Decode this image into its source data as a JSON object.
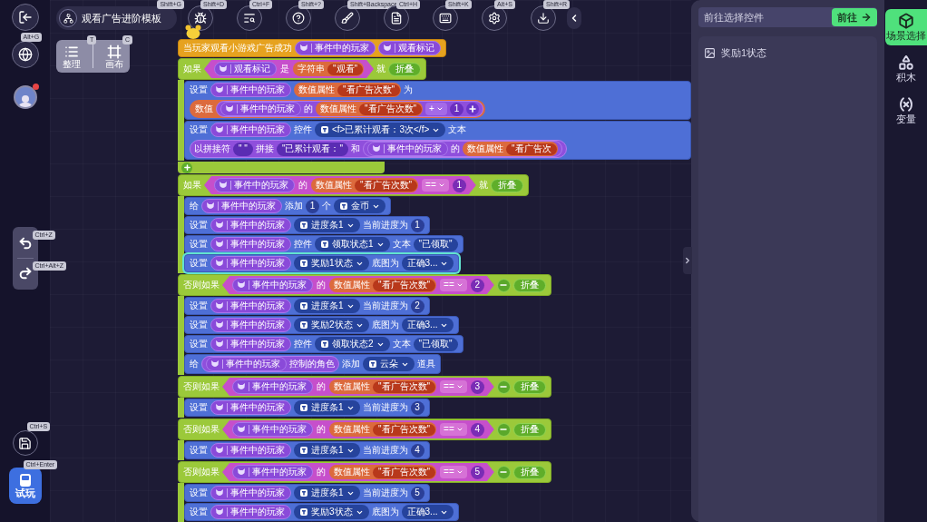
{
  "sidebar": {
    "globe_shortcut": "Alt+G",
    "avatar_notification": true,
    "undo_shortcut": "Ctrl+Z",
    "redo_shortcut": "Ctrl+Alt+Z",
    "save_shortcut": "Ctrl+S",
    "play": {
      "label": "试玩",
      "shortcut": "Ctrl+Enter"
    }
  },
  "project": {
    "title": "观看广告进阶模板",
    "shortcut": "Shift+G"
  },
  "tools": [
    {
      "shortcut": "Shift+D"
    },
    {
      "shortcut": "Ctrl+F"
    },
    {
      "shortcut": "Shift+?"
    },
    {
      "shortcut": "Shift+Backspace"
    },
    {
      "shortcut": "Ctrl+H"
    },
    {
      "shortcut": "Shift+K"
    },
    {
      "shortcut": "Alt+S"
    },
    {
      "shortcut": "Shift+R"
    }
  ],
  "arrange": {
    "tidy": {
      "label": "整理",
      "shortcut": "T"
    },
    "canvas": {
      "label": "画布",
      "shortcut": "C"
    }
  },
  "script": {
    "kind": "hat",
    "selected": false,
    "parts": [
      {
        "kind": "label",
        "text": "当玩家观看小游戏广告成功"
      },
      {
        "kind": "var",
        "text": "事件中的玩家"
      },
      {
        "kind": "var",
        "text": "观看标记"
      }
    ],
    "children": [
      {
        "kind": "if",
        "selected": false,
        "parts": [
          {
            "kind": "label",
            "text": "如果"
          },
          {
            "kind": "cond",
            "parts": [
              {
                "kind": "var",
                "text": "观看标记"
              },
              {
                "kind": "label",
                "text": "是"
              },
              {
                "kind": "attr",
                "label": "字符串",
                "value": "\"观看\""
              }
            ]
          },
          {
            "kind": "label",
            "text": "就"
          },
          {
            "kind": "fold",
            "text": "折叠"
          }
        ],
        "children": [
          {
            "kind": "stmt",
            "selected": false,
            "parts": [
              {
                "kind": "label",
                "text": "设置"
              },
              {
                "kind": "var",
                "text": "事件中的玩家"
              },
              {
                "kind": "attr",
                "label": "数值属性",
                "value": "\"看广告次数\""
              },
              {
                "kind": "label",
                "text": "为"
              },
              {
                "kind": "value",
                "label": "数值",
                "parts": [
                  {
                    "kind": "expr",
                    "parts": [
                      {
                        "kind": "var",
                        "text": "事件中的玩家"
                      },
                      {
                        "kind": "label",
                        "text": "的"
                      },
                      {
                        "kind": "attr",
                        "label": "数值属性",
                        "value": "\"看广告次数\""
                      },
                      {
                        "kind": "op",
                        "text": "+"
                      },
                      {
                        "kind": "num",
                        "text": "1"
                      },
                      {
                        "kind": "plus"
                      }
                    ]
                  }
                ]
              }
            ]
          },
          {
            "kind": "stmt",
            "selected": false,
            "parts": [
              {
                "kind": "label",
                "text": "设置"
              },
              {
                "kind": "var",
                "text": "事件中的玩家"
              },
              {
                "kind": "label",
                "text": "控件"
              },
              {
                "kind": "dropdown",
                "text": "<f>已累计观看：3次</f>",
                "icon": true
              },
              {
                "kind": "label",
                "text": "文本"
              },
              {
                "kind": "expr",
                "parts": [
                  {
                    "kind": "label",
                    "text": "以拼接符"
                  },
                  {
                    "kind": "str",
                    "text": "\" \""
                  },
                  {
                    "kind": "label",
                    "text": "拼接"
                  },
                  {
                    "kind": "str",
                    "text": "\"已累计观看：\""
                  },
                  {
                    "kind": "label",
                    "text": "和"
                  },
                  {
                    "kind": "expr",
                    "parts": [
                      {
                        "kind": "var",
                        "text": "事件中的玩家"
                      },
                      {
                        "kind": "label",
                        "text": "的"
                      },
                      {
                        "kind": "attr",
                        "label": "数值属性",
                        "value": "\"看广告次"
                      }
                    ]
                  }
                ]
              }
            ]
          }
        ]
      },
      {
        "kind": "add",
        "selected": false
      },
      {
        "kind": "if",
        "selected": false,
        "parts": [
          {
            "kind": "label",
            "text": "如果"
          },
          {
            "kind": "cond",
            "parts": [
              {
                "kind": "var",
                "text": "事件中的玩家"
              },
              {
                "kind": "label",
                "text": "的"
              },
              {
                "kind": "attr",
                "label": "数值属性",
                "value": "\"看广告次数\""
              },
              {
                "kind": "op",
                "text": "=="
              },
              {
                "kind": "num",
                "text": "1"
              }
            ]
          },
          {
            "kind": "label",
            "text": "就"
          },
          {
            "kind": "fold",
            "text": "折叠"
          }
        ],
        "children": [
          {
            "kind": "stmt",
            "selected": false,
            "parts": [
              {
                "kind": "label",
                "text": "给"
              },
              {
                "kind": "var",
                "text": "事件中的玩家"
              },
              {
                "kind": "label",
                "text": "添加"
              },
              {
                "kind": "num",
                "text": "1"
              },
              {
                "kind": "label",
                "text": "个"
              },
              {
                "kind": "dropdown",
                "text": "金币",
                "icon": true
              }
            ]
          },
          {
            "kind": "stmt",
            "selected": false,
            "parts": [
              {
                "kind": "label",
                "text": "设置"
              },
              {
                "kind": "var",
                "text": "事件中的玩家"
              },
              {
                "kind": "dropdown",
                "text": "进度条1",
                "icon": true
              },
              {
                "kind": "label",
                "text": "当前进度为"
              },
              {
                "kind": "num",
                "text": "1"
              }
            ]
          },
          {
            "kind": "stmt",
            "selected": false,
            "parts": [
              {
                "kind": "label",
                "text": "设置"
              },
              {
                "kind": "var",
                "text": "事件中的玩家"
              },
              {
                "kind": "label",
                "text": "控件"
              },
              {
                "kind": "dropdown",
                "text": "领取状态1",
                "icon": true
              },
              {
                "kind": "label",
                "text": "文本"
              },
              {
                "kind": "str",
                "text": "\"已领取\""
              }
            ]
          },
          {
            "kind": "stmt",
            "selected": true,
            "parts": [
              {
                "kind": "label",
                "text": "设置"
              },
              {
                "kind": "var",
                "text": "事件中的玩家"
              },
              {
                "kind": "dropdown",
                "text": "奖励1状态",
                "icon": true
              },
              {
                "kind": "label",
                "text": "底图为"
              },
              {
                "kind": "dropdown",
                "text": "正确3...",
                "icon": false
              }
            ]
          }
        ]
      },
      {
        "kind": "elseif",
        "selected": false,
        "parts": [
          {
            "kind": "label",
            "text": "否则如果"
          },
          {
            "kind": "cond",
            "parts": [
              {
                "kind": "var",
                "text": "事件中的玩家"
              },
              {
                "kind": "label",
                "text": "的"
              },
              {
                "kind": "attr",
                "label": "数值属性",
                "value": "\"看广告次数\""
              },
              {
                "kind": "op",
                "text": "=="
              },
              {
                "kind": "num",
                "text": "2"
              }
            ]
          },
          {
            "kind": "minus"
          },
          {
            "kind": "fold",
            "text": "折叠"
          }
        ],
        "children": [
          {
            "kind": "stmt",
            "selected": false,
            "parts": [
              {
                "kind": "label",
                "text": "设置"
              },
              {
                "kind": "var",
                "text": "事件中的玩家"
              },
              {
                "kind": "dropdown",
                "text": "进度条1",
                "icon": true
              },
              {
                "kind": "label",
                "text": "当前进度为"
              },
              {
                "kind": "num",
                "text": "2"
              }
            ]
          },
          {
            "kind": "stmt",
            "selected": false,
            "parts": [
              {
                "kind": "label",
                "text": "设置"
              },
              {
                "kind": "var",
                "text": "事件中的玩家"
              },
              {
                "kind": "dropdown",
                "text": "奖励2状态",
                "icon": true
              },
              {
                "kind": "label",
                "text": "底图为"
              },
              {
                "kind": "dropdown",
                "text": "正确3...",
                "icon": false
              }
            ]
          },
          {
            "kind": "stmt",
            "selected": false,
            "parts": [
              {
                "kind": "label",
                "text": "设置"
              },
              {
                "kind": "var",
                "text": "事件中的玩家"
              },
              {
                "kind": "label",
                "text": "控件"
              },
              {
                "kind": "dropdown",
                "text": "领取状态2",
                "icon": true
              },
              {
                "kind": "label",
                "text": "文本"
              },
              {
                "kind": "str",
                "text": "\"已领取\""
              }
            ]
          },
          {
            "kind": "stmt",
            "selected": false,
            "parts": [
              {
                "kind": "label",
                "text": "给"
              },
              {
                "kind": "expr",
                "parts": [
                  {
                    "kind": "var",
                    "text": "事件中的玩家"
                  },
                  {
                    "kind": "label",
                    "text": "控制的角色"
                  }
                ]
              },
              {
                "kind": "label",
                "text": "添加"
              },
              {
                "kind": "dropdown",
                "text": "云朵",
                "icon": true
              },
              {
                "kind": "label",
                "text": "道具"
              }
            ]
          }
        ]
      },
      {
        "kind": "elseif",
        "selected": false,
        "parts": [
          {
            "kind": "label",
            "text": "否则如果"
          },
          {
            "kind": "cond",
            "parts": [
              {
                "kind": "var",
                "text": "事件中的玩家"
              },
              {
                "kind": "label",
                "text": "的"
              },
              {
                "kind": "attr",
                "label": "数值属性",
                "value": "\"看广告次数\""
              },
              {
                "kind": "op",
                "text": "=="
              },
              {
                "kind": "num",
                "text": "3"
              }
            ]
          },
          {
            "kind": "minus"
          },
          {
            "kind": "fold",
            "text": "折叠"
          }
        ],
        "children": [
          {
            "kind": "stmt",
            "selected": false,
            "parts": [
              {
                "kind": "label",
                "text": "设置"
              },
              {
                "kind": "var",
                "text": "事件中的玩家"
              },
              {
                "kind": "dropdown",
                "text": "进度条1",
                "icon": true
              },
              {
                "kind": "label",
                "text": "当前进度为"
              },
              {
                "kind": "num",
                "text": "3"
              }
            ]
          }
        ]
      },
      {
        "kind": "elseif",
        "selected": false,
        "parts": [
          {
            "kind": "label",
            "text": "否则如果"
          },
          {
            "kind": "cond",
            "parts": [
              {
                "kind": "var",
                "text": "事件中的玩家"
              },
              {
                "kind": "label",
                "text": "的"
              },
              {
                "kind": "attr",
                "label": "数值属性",
                "value": "\"看广告次数\""
              },
              {
                "kind": "op",
                "text": "=="
              },
              {
                "kind": "num",
                "text": "4"
              }
            ]
          },
          {
            "kind": "minus"
          },
          {
            "kind": "fold",
            "text": "折叠"
          }
        ],
        "children": [
          {
            "kind": "stmt",
            "selected": false,
            "parts": [
              {
                "kind": "label",
                "text": "设置"
              },
              {
                "kind": "var",
                "text": "事件中的玩家"
              },
              {
                "kind": "dropdown",
                "text": "进度条1",
                "icon": true
              },
              {
                "kind": "label",
                "text": "当前进度为"
              },
              {
                "kind": "num",
                "text": "4"
              }
            ]
          }
        ]
      },
      {
        "kind": "elseif",
        "selected": false,
        "parts": [
          {
            "kind": "label",
            "text": "否则如果"
          },
          {
            "kind": "cond",
            "parts": [
              {
                "kind": "var",
                "text": "事件中的玩家"
              },
              {
                "kind": "label",
                "text": "的"
              },
              {
                "kind": "attr",
                "label": "数值属性",
                "value": "\"看广告次数\""
              },
              {
                "kind": "op",
                "text": "=="
              },
              {
                "kind": "num",
                "text": "5"
              }
            ]
          },
          {
            "kind": "minus"
          },
          {
            "kind": "fold",
            "text": "折叠"
          }
        ],
        "children": [
          {
            "kind": "stmt",
            "selected": false,
            "parts": [
              {
                "kind": "label",
                "text": "设置"
              },
              {
                "kind": "var",
                "text": "事件中的玩家"
              },
              {
                "kind": "dropdown",
                "text": "进度条1",
                "icon": true
              },
              {
                "kind": "label",
                "text": "当前进度为"
              },
              {
                "kind": "num",
                "text": "5"
              }
            ]
          },
          {
            "kind": "stmt",
            "selected": false,
            "parts": [
              {
                "kind": "label",
                "text": "设置"
              },
              {
                "kind": "var",
                "text": "事件中的玩家"
              },
              {
                "kind": "dropdown",
                "text": "奖励3状态",
                "icon": true
              },
              {
                "kind": "label",
                "text": "底图为"
              },
              {
                "kind": "dropdown",
                "text": "正确3...",
                "icon": false
              }
            ]
          }
        ]
      }
    ]
  },
  "panel": {
    "search": {
      "placeholder": "前往选择控件"
    },
    "go_button": "前往",
    "items": [
      {
        "label": "奖励1状态"
      }
    ]
  },
  "tabs": [
    {
      "label": "场景选择",
      "selected": true
    },
    {
      "label": "积木",
      "selected": false
    },
    {
      "label": "变量",
      "selected": false
    }
  ]
}
